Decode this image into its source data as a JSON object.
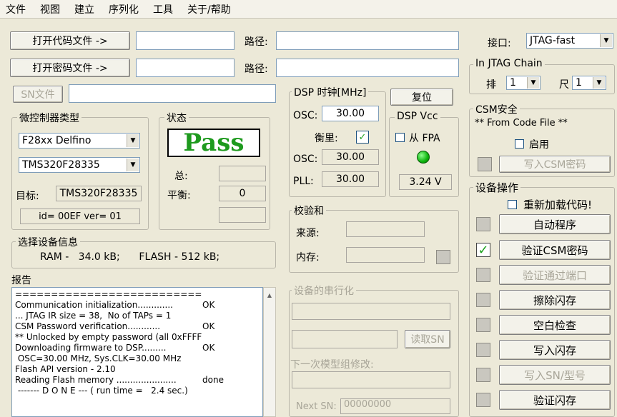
{
  "menu": [
    "文件",
    "视图",
    "建立",
    "序列化",
    "工具",
    "关于/帮助"
  ],
  "files": {
    "open_code_button": "打开代码文件 ->",
    "open_key_button": "打开密码文件 ->",
    "path_label": "路径:",
    "sn_file_button": "SN文件"
  },
  "interface": {
    "label": "接口:",
    "value": "JTAG-fast"
  },
  "jtag_chain": {
    "legend": "In JTAG Chain",
    "row_label": "排",
    "row_value": "1",
    "col_label": "尺",
    "col_value": "1"
  },
  "dsp_clock": {
    "legend": "DSP 时钟[MHz]",
    "osc_label": "OSC:",
    "osc_input": "30.00",
    "measure_label": "衡里:",
    "osc2_label": "OSC:",
    "osc2_value": "30.00",
    "pll_label": "PLL:",
    "pll_value": "30.00"
  },
  "reset_button": "复位",
  "dsp_vcc": {
    "legend": "DSP Vcc",
    "fpa_label": "从 FPA",
    "voltage": "3.24 V"
  },
  "csm": {
    "legend": "CSM安全",
    "source": "** From Code File **",
    "enable_label": "启用",
    "write_button": "写入CSM密码"
  },
  "mcu": {
    "legend": "微控制器类型",
    "family": "F28xx Delfino",
    "device": "TMS320F28335",
    "target_label": "目标:",
    "target_value": "TMS320F28335",
    "id_text": "id= 00EF ver= 01"
  },
  "status": {
    "legend": "状态",
    "pass": "Pass",
    "total_label": "总:",
    "balance_label": "平衡:",
    "balance_value": "0"
  },
  "device_info": {
    "legend": "选择设备信息",
    "text": "RAM -   34.0 kB;      FLASH - 512 kB;"
  },
  "checksum": {
    "legend": "校验和",
    "source_label": "来源:",
    "memory_label": "内存:"
  },
  "report": {
    "label": "报告",
    "lines": [
      [
        "==========================================",
        ""
      ],
      [
        "Communication initialization.............",
        "OK"
      ],
      [
        "... JTAG IR size = 38,  No of TAPs = 1",
        ""
      ],
      [
        "CSM Password verification............",
        "OK"
      ],
      [
        "** Unlocked by empty password (all 0xFFFF)",
        ""
      ],
      [
        "Downloading firmware to DSP.........",
        "OK"
      ],
      [
        " OSC=30.00 MHz, Sys.CLK=30.00 MHz",
        ""
      ],
      [
        "Flash API version - 2.10",
        ""
      ],
      [
        "Reading Flash memory ......................",
        "done"
      ],
      [
        " ------- D O N E --- ( run time =   2.4 sec.)",
        ""
      ]
    ]
  },
  "serial": {
    "legend": "设备的串行化",
    "read_sn_button": "读取SN",
    "next_model_label": "下一次模型组修改:",
    "next_sn_label": "Next SN:",
    "next_sn_value": "00000000"
  },
  "device_ops": {
    "legend": "设备操作",
    "reload_label": "重新加载代码!",
    "buttons": [
      {
        "label": "自动程序",
        "enabled": true,
        "checked": false
      },
      {
        "label": "验证CSM密码",
        "enabled": true,
        "checked": true
      },
      {
        "label": "验证通过端口",
        "enabled": false,
        "checked": false
      },
      {
        "label": "擦除闪存",
        "enabled": true,
        "checked": false
      },
      {
        "label": "空白检查",
        "enabled": true,
        "checked": false
      },
      {
        "label": "写入闪存",
        "enabled": true,
        "checked": false
      },
      {
        "label": "写入SN/型号",
        "enabled": false,
        "checked": false
      },
      {
        "label": "验证闪存",
        "enabled": true,
        "checked": false
      }
    ]
  }
}
